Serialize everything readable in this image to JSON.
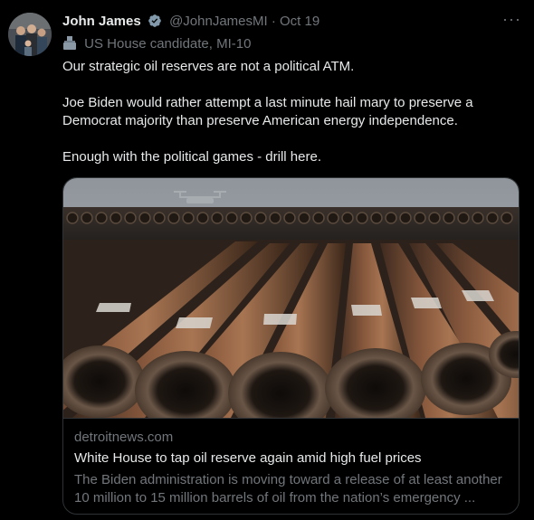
{
  "tweet": {
    "name": "John James",
    "handle": "@JohnJamesMI",
    "separator": "·",
    "date": "Oct 19",
    "more_label": "···",
    "label": "US House candidate, MI-10",
    "paragraphs": [
      "Our strategic oil reserves are not a political ATM.",
      "Joe Biden would rather attempt a last minute hail mary to preserve a Democrat majority than preserve American energy independence.",
      "Enough with the political games - drill here."
    ]
  },
  "card": {
    "domain": "detroitnews.com",
    "title": "White House to tap oil reserve again amid high fuel prices",
    "description": "The Biden administration is moving toward a release of at least another 10 million to 15 million barrels of oil from the nation’s emergency ..."
  },
  "colors": {
    "background": "#000000",
    "text_primary": "#e7e9ea",
    "text_secondary": "#71767b",
    "verified": "#829aab",
    "border": "#2f3336"
  }
}
